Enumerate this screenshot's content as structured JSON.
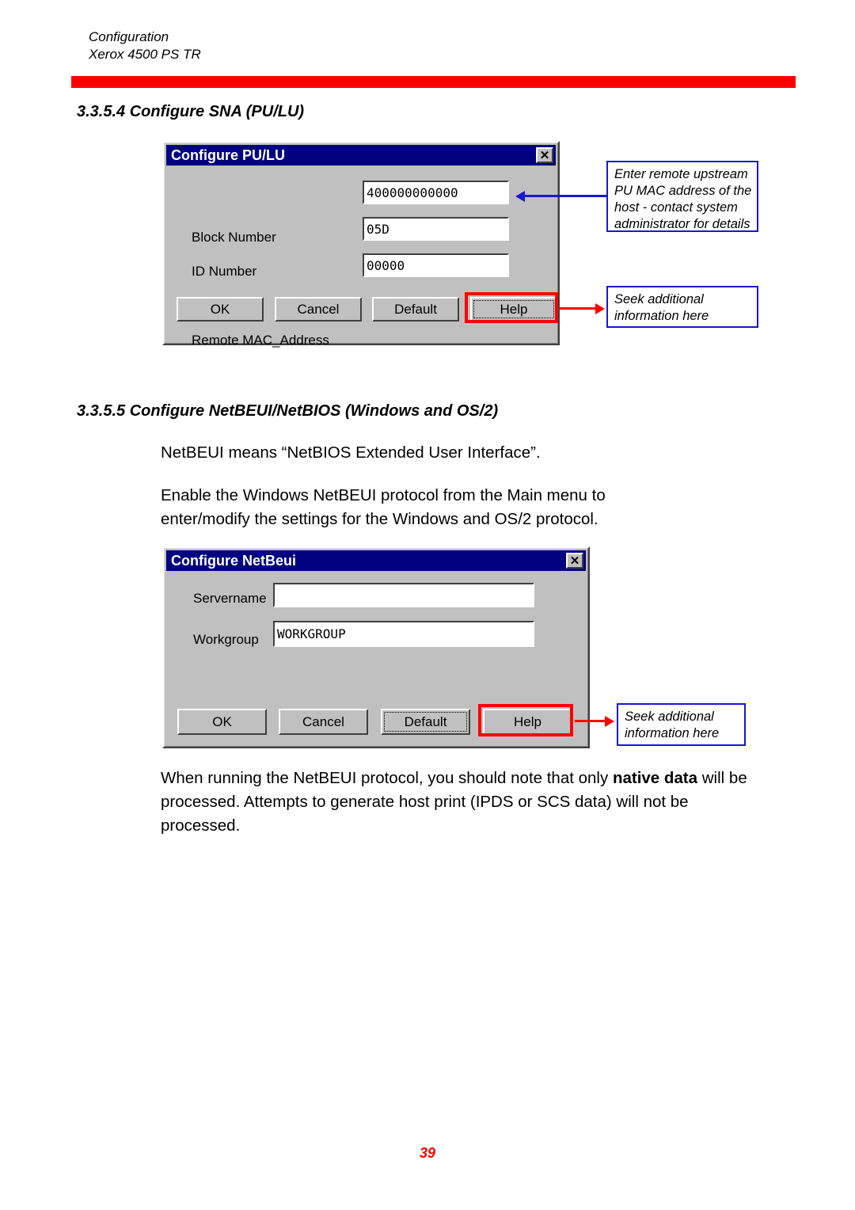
{
  "page": {
    "header_line1": "Configuration",
    "header_line2": "Xerox 4500 PS TR",
    "rule_color": "#ff0000",
    "page_number": "39"
  },
  "sections": [
    {
      "heading": "3.3.5.4 Configure SNA (PU/LU)"
    },
    {
      "heading": "3.3.5.5 Configure NetBEUI/NetBIOS (Windows and OS/2)"
    }
  ],
  "paragraphs": {
    "netbeui_means": "NetBEUI means “NetBIOS Extended User Interface”.",
    "enable_line1": "Enable the Windows NetBEUI protocol from the Main menu to",
    "enable_line2": "enter/modify the settings for the Windows and OS/2 protocol.",
    "when_running_a": "When running the NetBEUI protocol, you should note that only ",
    "when_running_bold": "native data",
    "when_running_b": "will be processed. Attempts to generate host print (IPDS or SCS data) will not be processed."
  },
  "dialog_pulu": {
    "title": "Configure PU/LU",
    "close_label": "✕",
    "fields": [
      {
        "label": "Remote MAC_Address",
        "value": "400000000000"
      },
      {
        "label": "Block Number",
        "value": "05D"
      },
      {
        "label": "ID Number",
        "value": "00000"
      }
    ],
    "buttons": [
      {
        "label": "OK"
      },
      {
        "label": "Cancel"
      },
      {
        "label": "Default"
      },
      {
        "label": "Help"
      }
    ]
  },
  "dialog_netbeui": {
    "title": "Configure NetBeui",
    "close_label": "✕",
    "fields": [
      {
        "label": "Servername",
        "value": ""
      },
      {
        "label": "Workgroup",
        "value": "WORKGROUP"
      }
    ],
    "buttons": [
      {
        "label": "OK"
      },
      {
        "label": "Cancel"
      },
      {
        "label": "Default"
      },
      {
        "label": "Help"
      }
    ]
  },
  "callouts": {
    "mac_address": {
      "line1": "Enter remote upstream",
      "line2": "PU MAC address of the",
      "line3": "host - contact system",
      "line4": "administrator for details",
      "border_color": "#1818d0",
      "arrow_color": "#1818d0"
    },
    "help_pulu": {
      "line1": "Seek additional",
      "line2": "information here",
      "border_color": "#1818d0",
      "arrow_color": "#ff0000"
    },
    "help_netbeui": {
      "line1": "Seek additional",
      "line2": "information here",
      "border_color": "#1818d0",
      "arrow_color": "#ff0000"
    }
  }
}
